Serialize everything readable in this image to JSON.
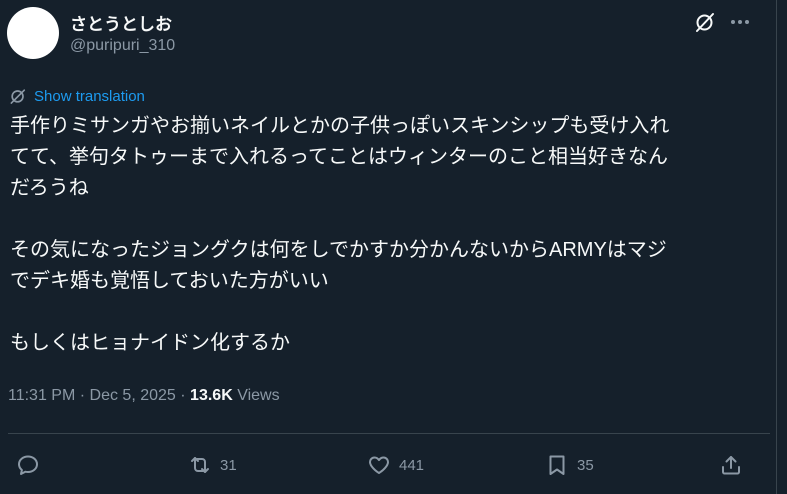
{
  "user": {
    "display_name": "さとうとしお",
    "handle": "@puripuri_310"
  },
  "header_icons": {
    "grok": "grok-icon",
    "more": "more-icon"
  },
  "translate": {
    "icon": "translate-icon",
    "label": "Show translation"
  },
  "tweet": {
    "lines": [
      "手作りミサンガやお揃いネイルとかの子供っぽいスキンシップも受け入れ",
      "てて、挙句タトゥーまで入れるってことはウィンターのこと相当好きなん",
      "だろうね",
      "",
      "その気になったジョングクは何をしでかすか分かんないからARMYはマジ",
      "でデキ婚も覚悟しておいた方がいい",
      "",
      "もしくはヒョナイドン化するか"
    ]
  },
  "meta": {
    "time": "11:31 PM",
    "separator": "·",
    "date": "Dec 5, 2025",
    "views_count": "13.6K",
    "views_label": "Views"
  },
  "actions": {
    "reply": {
      "icon": "reply-icon",
      "count": ""
    },
    "retweet": {
      "icon": "retweet-icon",
      "count": "31"
    },
    "like": {
      "icon": "heart-icon",
      "count": "441"
    },
    "bookmark": {
      "icon": "bookmark-icon",
      "count": "35"
    },
    "share": {
      "icon": "share-icon",
      "count": ""
    }
  },
  "colors": {
    "background": "#15202b",
    "text": "#f7f9f9",
    "secondary": "#8b98a5",
    "accent": "#1d9bf0",
    "border": "#38444d"
  }
}
